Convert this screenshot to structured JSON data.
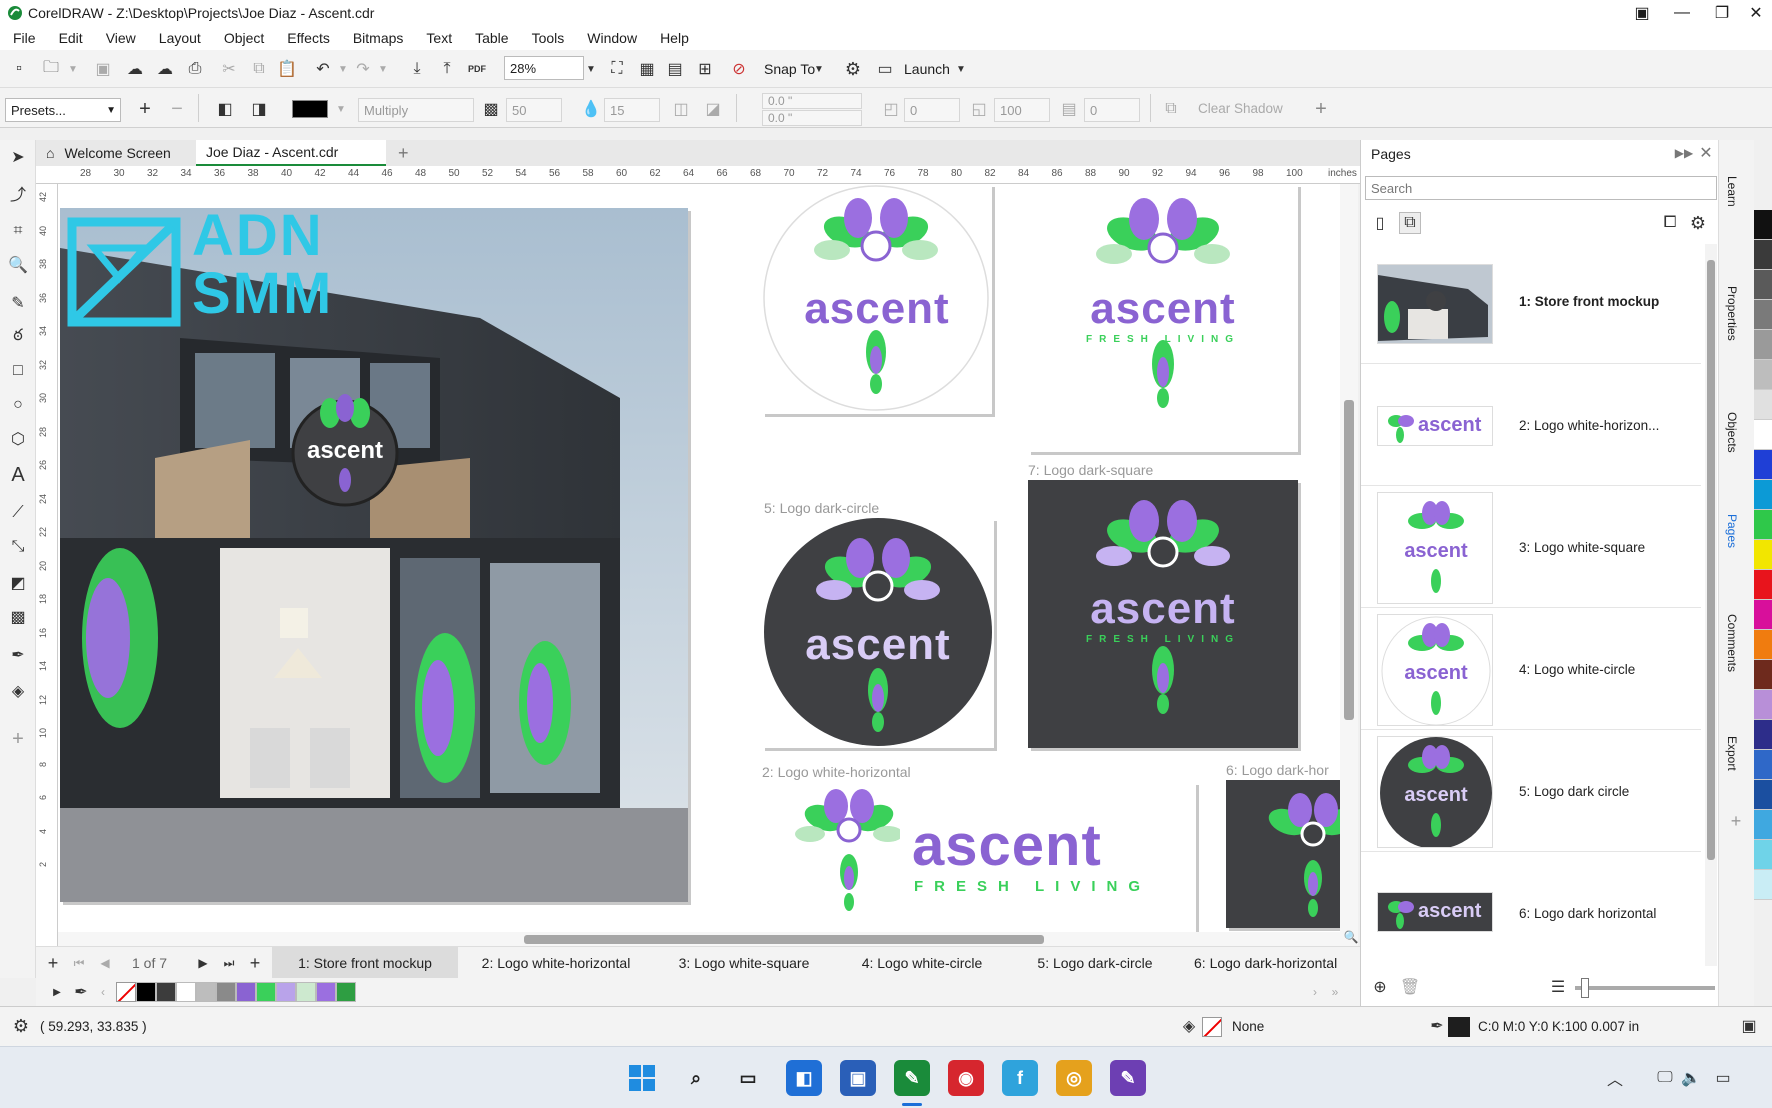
{
  "window": {
    "title": "CorelDRAW - Z:\\Desktop\\Projects\\Joe Diaz - Ascent.cdr"
  },
  "menu": [
    "File",
    "Edit",
    "View",
    "Layout",
    "Object",
    "Effects",
    "Bitmaps",
    "Text",
    "Table",
    "Tools",
    "Window",
    "Help"
  ],
  "toolbar": {
    "zoom": "28%",
    "snap_to": "Snap To",
    "launch": "Launch",
    "pdf": "PDF"
  },
  "propbar": {
    "presets": "Presets...",
    "blend_mode": "Multiply",
    "opacity": "50",
    "feather": "15",
    "offset_x": "0.0 \"",
    "offset_y": "0.0 \"",
    "angle": "0",
    "stretch": "100",
    "fade": "0",
    "clear_shadow": "Clear Shadow"
  },
  "tabs": {
    "welcome": "Welcome Screen",
    "document": "Joe Diaz - Ascent.cdr"
  },
  "ruler": {
    "top_ticks": [
      "28",
      "30",
      "32",
      "34",
      "36",
      "38",
      "40",
      "42",
      "44",
      "46",
      "48",
      "50",
      "52",
      "54",
      "56",
      "58",
      "60",
      "62",
      "64",
      "66",
      "68",
      "70",
      "72",
      "74",
      "76",
      "78",
      "80",
      "82",
      "84",
      "86",
      "88",
      "90",
      "92",
      "94",
      "96",
      "98",
      "100"
    ],
    "unit": "inches",
    "left_ticks": [
      "42",
      "40",
      "38",
      "36",
      "34",
      "32",
      "30",
      "28",
      "26",
      "24",
      "22",
      "20",
      "18",
      "16",
      "14",
      "12",
      "10",
      "8",
      "6",
      "4",
      "2"
    ]
  },
  "canvas": {
    "watermark_line1": "ADN",
    "watermark_line2": "SMM",
    "brand": "ascent",
    "tagline": "FRESH LIVING",
    "label_page5": "5: Logo dark-circle",
    "label_page7": "7: Logo dark-square",
    "label_page2": "2: Logo white-horizontal",
    "label_page6": "6: Logo dark-hor"
  },
  "pages_nav": {
    "counter": "1 of 7",
    "tabs": [
      "1: Store front mockup",
      "2: Logo white-horizontal",
      "3: Logo white-square",
      "4: Logo white-circle",
      "5: Logo dark-circle",
      "6: Logo dark-horizontal"
    ]
  },
  "pages_panel": {
    "title": "Pages",
    "search_placeholder": "Search",
    "items": [
      "1: Store front mockup",
      "2: Logo white-horizon...",
      "3: Logo white-square",
      "4: Logo white-circle",
      "5: Logo dark circle",
      "6: Logo dark horizontal"
    ]
  },
  "docker_tabs": [
    "Learn",
    "Properties",
    "Objects",
    "Pages",
    "Comments",
    "Export"
  ],
  "status": {
    "coords": "( 59.293, 33.835 )",
    "fill": "None",
    "outline": "C:0 M:0 Y:0 K:100  0.007 in"
  },
  "colors": {
    "accent": "#8a63d2",
    "green": "#3ad05a",
    "dark": "#3f4043",
    "watermark": "#2fc8e6"
  },
  "palette": [
    "#000000",
    "#3c3c3c",
    "#ffffff",
    "#bdbdbd",
    "#8a8a8a",
    "#8a63d2",
    "#3ad05a",
    "#b9a3ea",
    "#cde9cf",
    "#9b6fe0",
    "#2e9e42"
  ],
  "color_strip": [
    "#111111",
    "#3a3a3a",
    "#5a5a5a",
    "#7a7a7a",
    "#9a9a9a",
    "#bdbdbd",
    "#e0e0e0",
    "#ffffff",
    "#1f3fd6",
    "#0c9ad6",
    "#2fc84a",
    "#f2e600",
    "#e8141c",
    "#d80f9b",
    "#f07c0f",
    "#6e2a1d",
    "#b88fd8",
    "#2d2d8a",
    "#2f68c8",
    "#1b4fa0",
    "#3fa8e0",
    "#6fd3e8",
    "#c9edf5"
  ]
}
